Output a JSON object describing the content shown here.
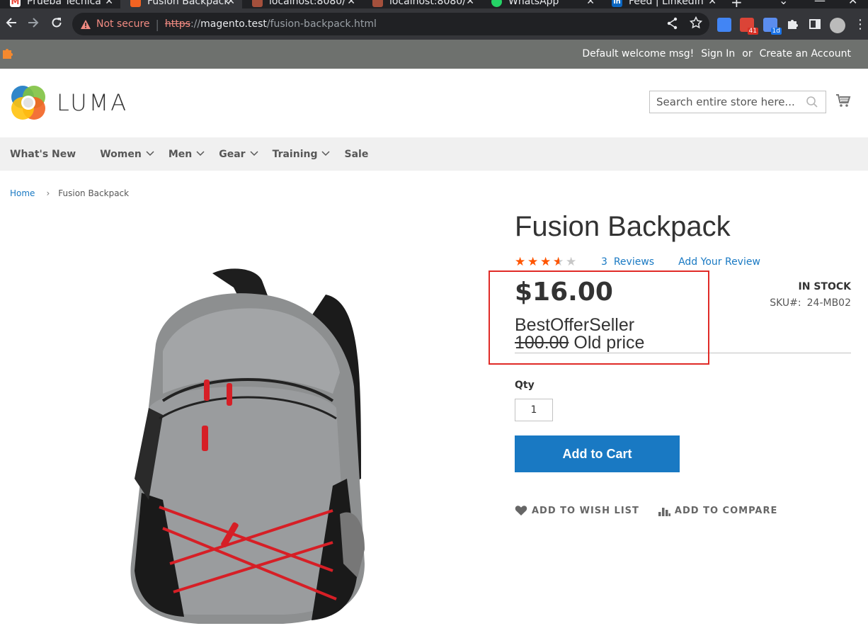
{
  "browser": {
    "tabs": [
      {
        "title": "Prueba Técnica",
        "favicon": "gmail-icon",
        "color": "#ea4335",
        "active": false
      },
      {
        "title": "Fusion Backpack",
        "favicon": "magento-icon",
        "color": "#f26322",
        "active": true
      },
      {
        "title": "localhost:8080/",
        "favicon": "app-icon",
        "color": "#a4503c",
        "active": false
      },
      {
        "title": "localhost:8080/",
        "favicon": "app-icon",
        "color": "#a4503c",
        "active": false
      },
      {
        "title": "WhatsApp",
        "favicon": "whatsapp-icon",
        "color": "#25d366",
        "active": false
      },
      {
        "title": "Feed | LinkedIn",
        "favicon": "linkedin-icon",
        "color": "#0a66c2",
        "active": false
      }
    ],
    "security_label": "Not secure",
    "url_scheme": "https",
    "url_sep": "://",
    "url_host": "magento.test",
    "url_path": "/fusion-backpack.html",
    "ext_badges": {
      "mail": "41",
      "calendar": "1d"
    }
  },
  "panel": {
    "welcome": "Default welcome msg!",
    "sign_in": "Sign In",
    "or": "or",
    "create_account": "Create an Account"
  },
  "header": {
    "logo_text": "LUMA",
    "search_placeholder": "Search entire store here..."
  },
  "nav": {
    "items": [
      {
        "label": "What's New",
        "has_menu": false
      },
      {
        "label": "Women",
        "has_menu": true
      },
      {
        "label": "Men",
        "has_menu": true
      },
      {
        "label": "Gear",
        "has_menu": true
      },
      {
        "label": "Training",
        "has_menu": true
      },
      {
        "label": "Sale",
        "has_menu": false
      }
    ]
  },
  "breadcrumbs": {
    "home": "Home",
    "current": "Fusion Backpack"
  },
  "product": {
    "name": "Fusion Backpack",
    "rating": 3.5,
    "rating_max": 5,
    "review_count": "3",
    "reviews_label": "Reviews",
    "add_review": "Add Your Review",
    "stock": "In stock",
    "sku_label": "SKU#:",
    "sku": "24-MB02",
    "price": "$16.00",
    "seller": "BestOfferSeller",
    "old_price": "100.00",
    "old_price_label": "Old price",
    "qty_label": "Qty",
    "qty": "1",
    "add_to_cart": "Add to Cart",
    "wishlist": "ADD TO WISH LIST",
    "compare": "ADD TO COMPARE"
  },
  "colors": {
    "accent": "#1979c3",
    "star": "#ff5501",
    "highlight": "#e02b27"
  }
}
